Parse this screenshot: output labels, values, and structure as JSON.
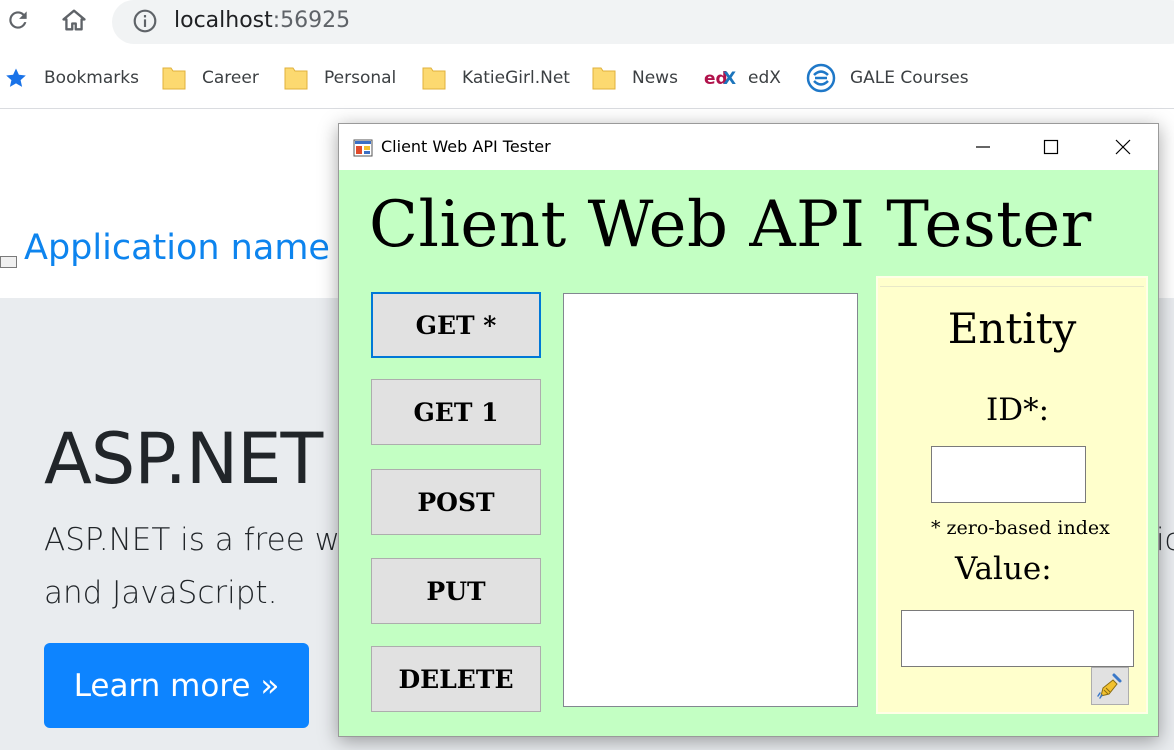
{
  "browser": {
    "url_host": "localhost",
    "url_port": ":56925",
    "bookmarks": [
      {
        "label": "Bookmarks",
        "icon": "star-icon"
      },
      {
        "label": "Career",
        "icon": "folder-icon"
      },
      {
        "label": "Personal",
        "icon": "folder-icon"
      },
      {
        "label": "KatieGirl.Net",
        "icon": "folder-icon"
      },
      {
        "label": "News",
        "icon": "folder-icon"
      },
      {
        "label": "edX",
        "icon": "edx-logo-icon"
      },
      {
        "label": "GALE Courses",
        "icon": "gale-logo-icon"
      }
    ]
  },
  "page": {
    "app_name": "Application name",
    "jumbo_title": "ASP.NET",
    "lead_line1": "ASP.NET is a free we",
    "lead_line1_right": "ic",
    "lead_line2": "and JavaScript.",
    "learn_more": "Learn more »"
  },
  "window": {
    "title": "Client Web API Tester",
    "heading": "Client Web API Tester",
    "buttons": {
      "get_all": "GET *",
      "get_one": "GET 1",
      "post": "POST",
      "put": "PUT",
      "delete": "DELETE"
    },
    "entity": {
      "title": "Entity",
      "id_label": "ID*:",
      "id_value": "",
      "hint": "* zero-based index",
      "value_label": "Value:",
      "value_value": ""
    }
  },
  "colors": {
    "form_background": "#c3ffc3",
    "entity_panel": "#ffffcc",
    "link_blue": "#0d84ee",
    "button_primary": "#0d84ff",
    "jumbotron": "#e9ecef"
  }
}
